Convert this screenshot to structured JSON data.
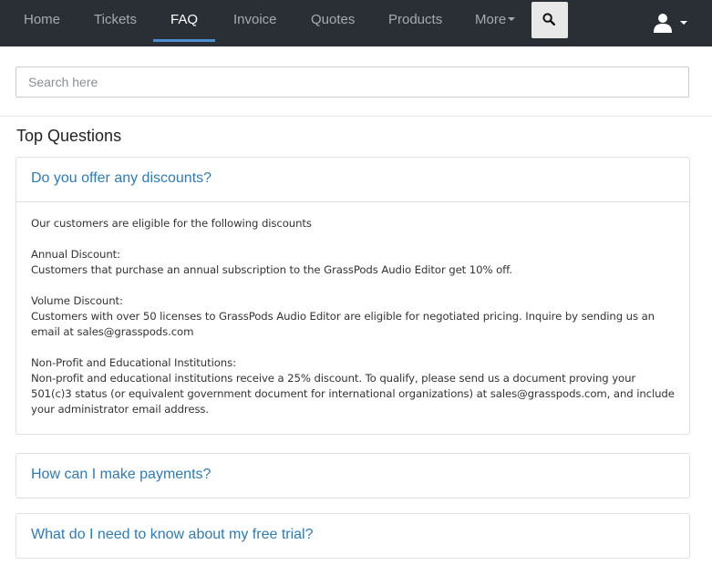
{
  "nav": {
    "items": [
      {
        "label": "Home"
      },
      {
        "label": "Tickets"
      },
      {
        "label": "FAQ"
      },
      {
        "label": "Invoice"
      },
      {
        "label": "Quotes"
      },
      {
        "label": "Products"
      },
      {
        "label": "More"
      }
    ],
    "active": "FAQ",
    "search_icon": "search-icon",
    "user_icon": "user-icon"
  },
  "search": {
    "placeholder": "Search here",
    "value": ""
  },
  "top_questions": {
    "title": "Top Questions",
    "items": [
      {
        "question": "Do you offer any discounts?",
        "expanded": true,
        "answer": {
          "intro": "Our customers are eligible for the following discounts",
          "annual_heading": "Annual Discount:",
          "annual_text": "Customers that purchase an annual subscription to the GrassPods Audio Editor get 10% off.",
          "volume_heading": "Volume Discount:",
          "volume_text": "Customers with over 50 licenses to GrassPods Audio Editor are eligible for negotiated pricing. Inquire by sending us an email at sales@grasspods.com",
          "nonprofit_heading": "Non-Profit and Educational Institutions:",
          "nonprofit_text": "Non-profit and educational institutions receive a 25% discount. To qualify, please send us a document proving your 501(c)3 status (or equivalent government document for international organizations) at sales@grasspods.com, and include your administrator email address."
        }
      },
      {
        "question": "How can I make payments?",
        "expanded": false
      },
      {
        "question": "What do I need to know about my free trial?",
        "expanded": false
      }
    ]
  },
  "colors": {
    "navbar_bg": "#2a2e35",
    "accent": "#4d8ed1",
    "link": "#2f7bb6"
  }
}
